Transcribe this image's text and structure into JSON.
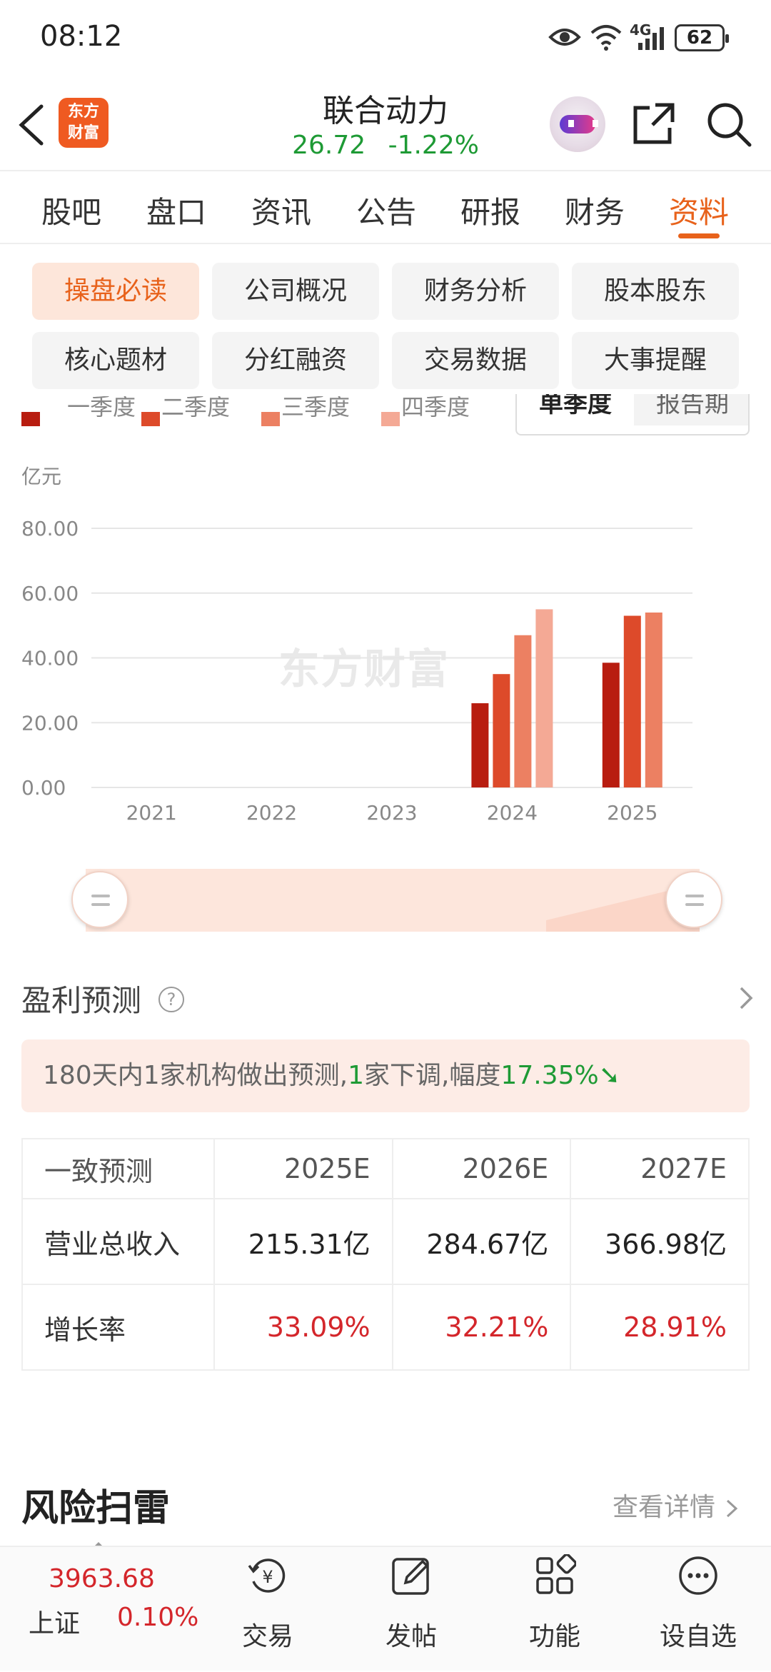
{
  "status_bar": {
    "time": "08:12",
    "battery": "62",
    "network": "4G"
  },
  "header": {
    "logo_line1": "东方",
    "logo_line2": "财富",
    "stock_name": "联合动力",
    "price": "26.72",
    "change_pct": "-1.22%"
  },
  "tabs": [
    "股吧",
    "盘口",
    "资讯",
    "公告",
    "研报",
    "财务",
    "资料"
  ],
  "active_tab": "资料",
  "chips": [
    "操盘必读",
    "公司概况",
    "财务分析",
    "股本股东",
    "核心题材",
    "分红融资",
    "交易数据",
    "大事提醒"
  ],
  "active_chip": "操盘必读",
  "period_toggle": {
    "selected": "单季度",
    "other": "报告期"
  },
  "legend": [
    "一季度",
    "二季度",
    "三季度",
    "四季度"
  ],
  "colors": {
    "q1": "#b81d10",
    "q2": "#dd4a2a",
    "q3": "#ec8062",
    "q4": "#f4a995",
    "accent": "#e8621b",
    "up_red": "#d4262b",
    "down_green": "#1e9a35"
  },
  "chart_data": {
    "type": "bar",
    "ylabel": "亿元",
    "ylim": [
      0,
      80
    ],
    "yticks": [
      "0.00",
      "20.00",
      "40.00",
      "60.00",
      "80.00"
    ],
    "categories": [
      "2021",
      "2022",
      "2023",
      "2024",
      "2025"
    ],
    "series": [
      {
        "name": "一季度",
        "values": [
          null,
          null,
          null,
          26,
          38.5
        ]
      },
      {
        "name": "二季度",
        "values": [
          null,
          null,
          null,
          35,
          53
        ]
      },
      {
        "name": "三季度",
        "values": [
          null,
          null,
          null,
          47,
          54
        ]
      },
      {
        "name": "四季度",
        "values": [
          null,
          null,
          null,
          55,
          null
        ]
      }
    ],
    "watermark": "东方财富"
  },
  "profit_forecast": {
    "title": "盈利预测",
    "banner_part1": "180天内1家机构做出预测,",
    "banner_num": "1",
    "banner_part2": "家下调,幅度",
    "banner_pct": "17.35%",
    "table": {
      "header": [
        "一致预测",
        "2025E",
        "2026E",
        "2027E"
      ],
      "rows": [
        {
          "label": "营业总收入",
          "values": [
            "215.31亿",
            "284.67亿",
            "366.98亿"
          ]
        },
        {
          "label": "增长率",
          "values": [
            "33.09%",
            "32.21%",
            "28.91%"
          ]
        }
      ]
    }
  },
  "risk": {
    "title": "风险扫雷",
    "link": "查看详情"
  },
  "bottom_bar": {
    "index_value": "3963.68",
    "index_name": "上证",
    "index_change": "0.10%",
    "nav": [
      "交易",
      "发帖",
      "功能",
      "设自选"
    ]
  }
}
